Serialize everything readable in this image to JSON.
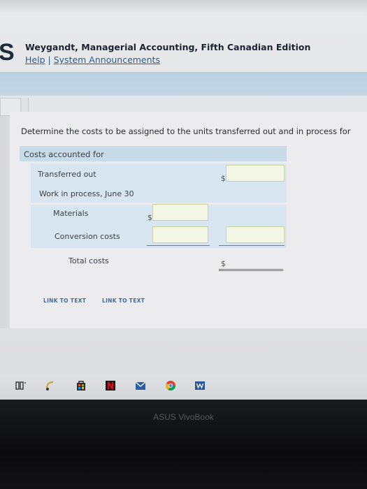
{
  "header": {
    "logo_letter": "S",
    "title": "Weygandt, Managerial Accounting, Fifth Canadian Edition",
    "help_link": "Help",
    "separator": "|",
    "announcements_link": "System Announcements"
  },
  "question": {
    "prompt": "Determine the costs to be assigned to the units transferred out and in process for"
  },
  "table": {
    "header": "Costs accounted for",
    "transferred_out": "Transferred out",
    "wip": "Work in process, June 30",
    "materials": "Materials",
    "conversion": "Conversion costs",
    "total": "Total costs",
    "currency_symbol": "$",
    "inputs": {
      "transferred_out": "",
      "materials": "",
      "conversion_left": "",
      "conversion_right": ""
    }
  },
  "links": {
    "link1": "LINK TO TEXT",
    "link2": "LINK TO TEXT"
  },
  "taskbar": {
    "icons": [
      "taskview-icon",
      "timeline-icon",
      "store-icon",
      "netflix-icon",
      "mail-icon",
      "chrome-icon",
      "word-icon"
    ]
  },
  "laptop": {
    "brand": "ASUS VivoBook"
  }
}
